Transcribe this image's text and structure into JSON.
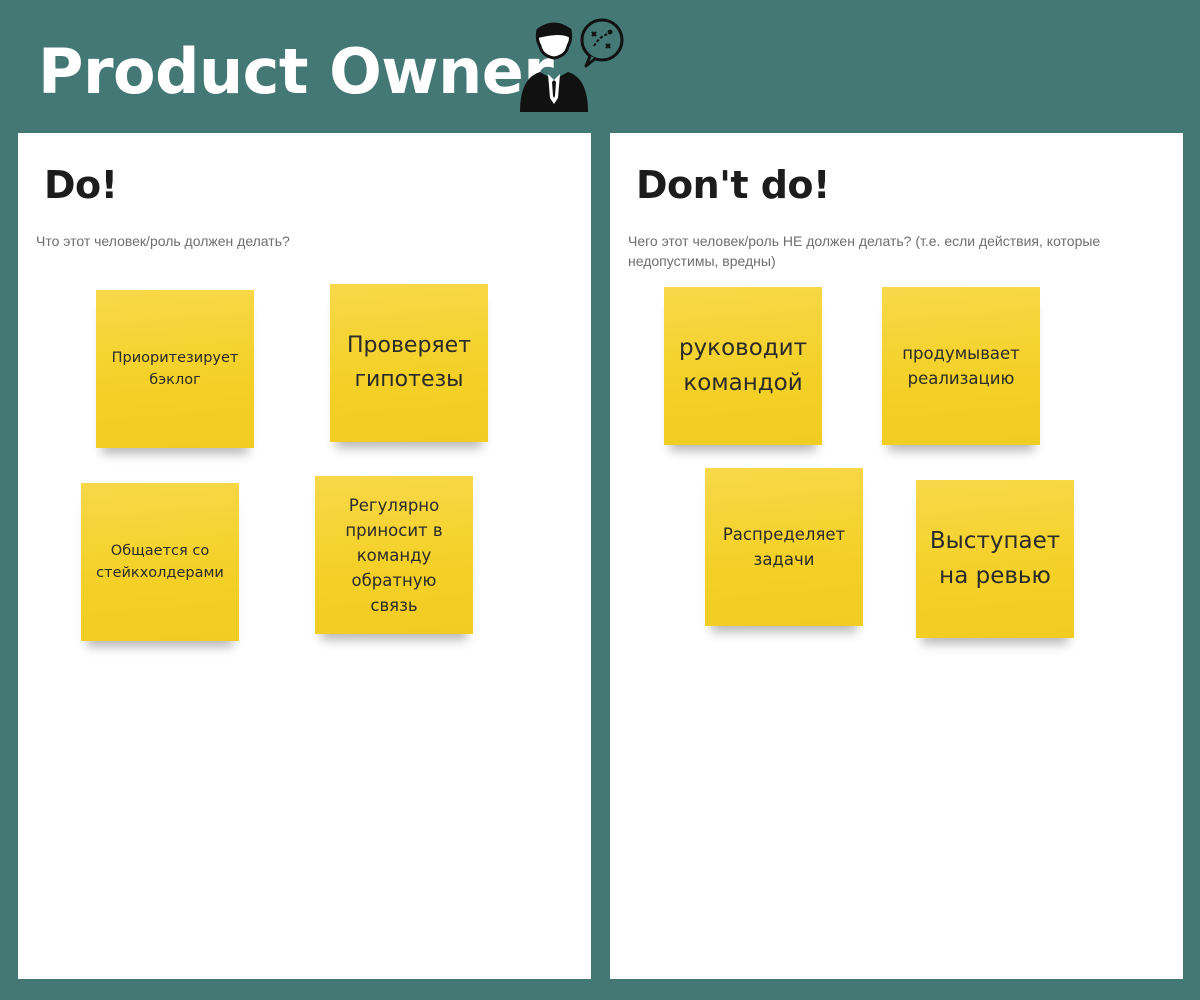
{
  "header": {
    "title": "Product Owner",
    "icon": "businessman-strategy-icon"
  },
  "panels": {
    "do": {
      "heading": "Do!",
      "description": "Что этот человек/роль должен делать?",
      "stickies": [
        "Приоритезирует бэклог",
        "Проверяет\nгипотезы",
        "Общается со стейкхолдерами",
        "Регулярно\nприносит в\nкоманду\nобратную\nсвязь"
      ]
    },
    "dont": {
      "heading": "Don't do!",
      "description": "Чего этот человек/роль НЕ должен делать? (т.е. если действия, которые недопустимы, вредны)",
      "stickies": [
        "руководит\nкомандой",
        "продумывает\nреализацию",
        "Распределяет\nзадачи",
        "Выступает\nна ревью"
      ]
    }
  },
  "colors": {
    "background": "#437875",
    "panel": "#ffffff",
    "sticky": "#f4d128"
  }
}
